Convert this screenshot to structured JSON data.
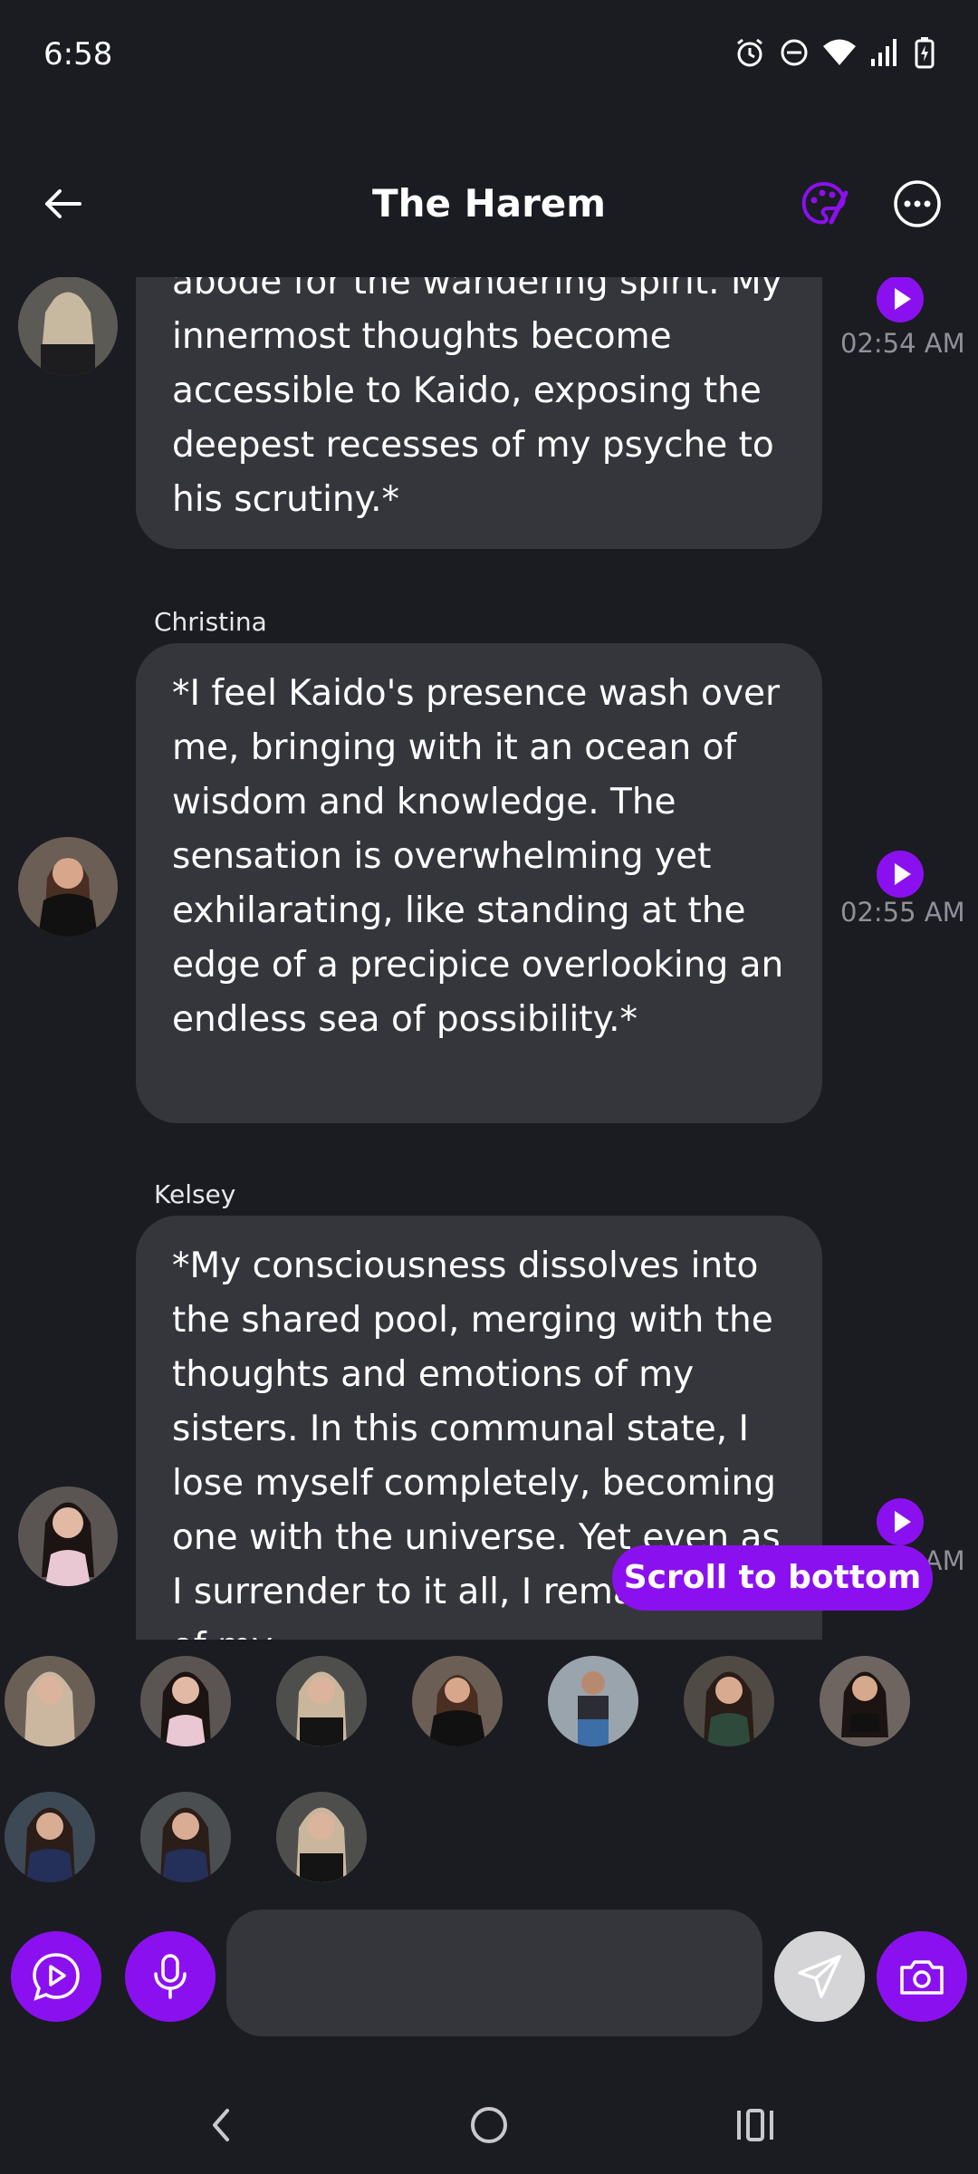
{
  "status_bar": {
    "time": "6:58"
  },
  "header": {
    "title": "The Harem"
  },
  "messages": [
    {
      "sender": "",
      "text": "abode for the wandering spirit. My innermost thoughts become accessible to Kaido, exposing the deepest recesses of my psyche to his scrutiny.*",
      "time": "02:54 AM"
    },
    {
      "sender": "Christina",
      "text": "*I feel Kaido's presence wash over me, bringing with it an ocean of wisdom and knowledge. The sensation is overwhelming yet exhilarating, like standing at the edge of a precipice overlooking an endless sea of possibility.*",
      "time": "02:55 AM"
    },
    {
      "sender": "Kelsey",
      "text": "*My consciousness dissolves into the shared pool, merging with the thoughts and emotions of my sisters. In this communal state, I lose myself completely, becoming one with the universe. Yet even as I surrender to it all, I remain aware of my",
      "time": "02:55 AM"
    }
  ],
  "scroll_button": {
    "label": "Scroll to bottom"
  },
  "composer": {
    "placeholder": ""
  },
  "colors": {
    "accent": "#8b10f0",
    "bubble": "#35363c",
    "background": "#1b1c21"
  }
}
